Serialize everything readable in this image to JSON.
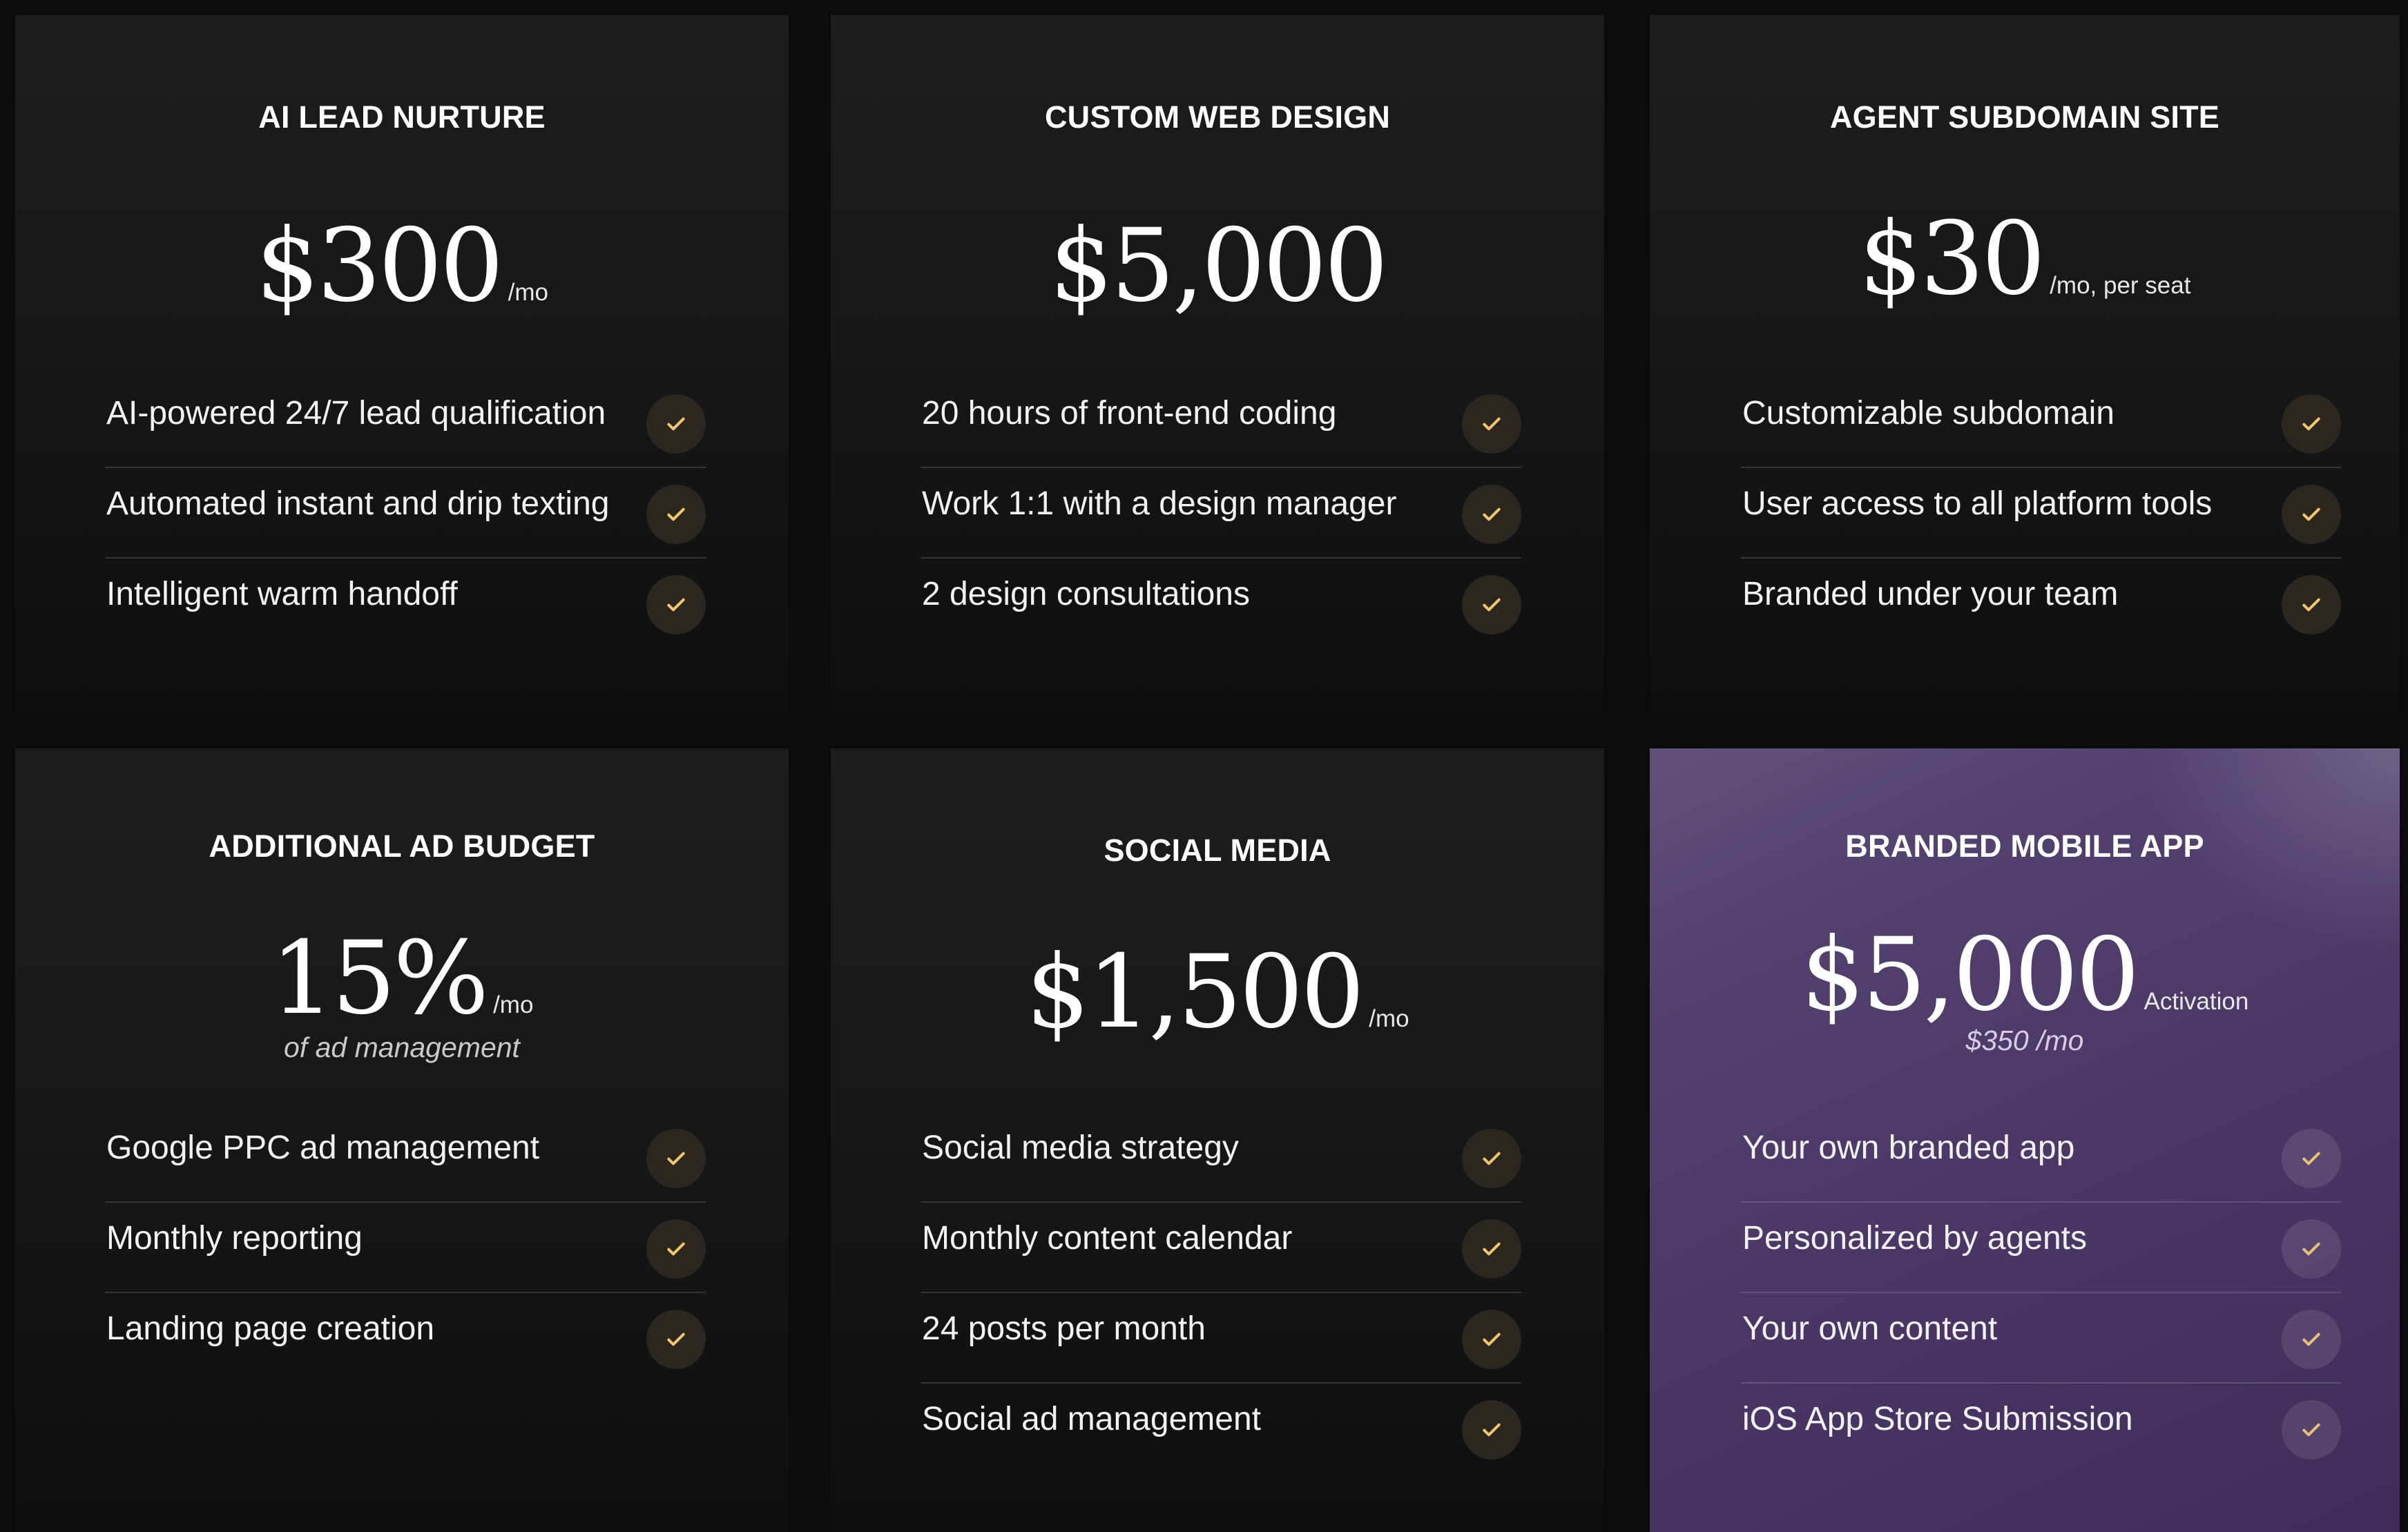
{
  "colors": {
    "page_background": "#0b0b0b",
    "card_background": "#1a1a1a",
    "highlight_card": "#4a3766",
    "check_accent": "#f2c46d",
    "check_circle": "#2b261e"
  },
  "cards": [
    {
      "title": "AI LEAD NURTURE",
      "price": "$300",
      "unit": "/mo",
      "features": [
        "AI-powered 24/7 lead qualification",
        "Automated instant and drip texting",
        "Intelligent warm handoff"
      ],
      "check_icon": "checkmark-icon"
    },
    {
      "title": "CUSTOM WEB DESIGN",
      "price": "$5,000",
      "features": [
        "20 hours of front-end coding",
        "Work 1:1 with a design manager",
        "2 design consultations"
      ],
      "check_icon": "checkmark-icon"
    },
    {
      "title": "AGENT SUBDOMAIN SITE",
      "price": "$30",
      "unit": "/mo, per seat",
      "features": [
        "Customizable subdomain",
        "User access to all platform tools",
        "Branded under your team"
      ],
      "check_icon": "checkmark-icon"
    },
    {
      "title": "ADDITIONAL AD BUDGET",
      "price": "15%",
      "unit": "/mo",
      "sub": "of ad management",
      "features": [
        "Google PPC ad management",
        "Monthly reporting",
        "Landing page creation"
      ],
      "check_icon": "checkmark-icon"
    },
    {
      "title": "SOCIAL MEDIA",
      "price": "$1,500",
      "unit": "/mo",
      "features": [
        "Social media strategy",
        "Monthly content calendar",
        "24 posts per month",
        "Social ad management"
      ],
      "check_icon": "checkmark-icon"
    },
    {
      "title": "BRANDED MOBILE APP",
      "price": "$5,000",
      "unit": "Activation",
      "sub": "$350 /mo",
      "features": [
        "Your own branded app",
        "Personalized by agents",
        "Your own content",
        "iOS App Store Submission"
      ],
      "check_icon": "checkmark-icon"
    }
  ]
}
